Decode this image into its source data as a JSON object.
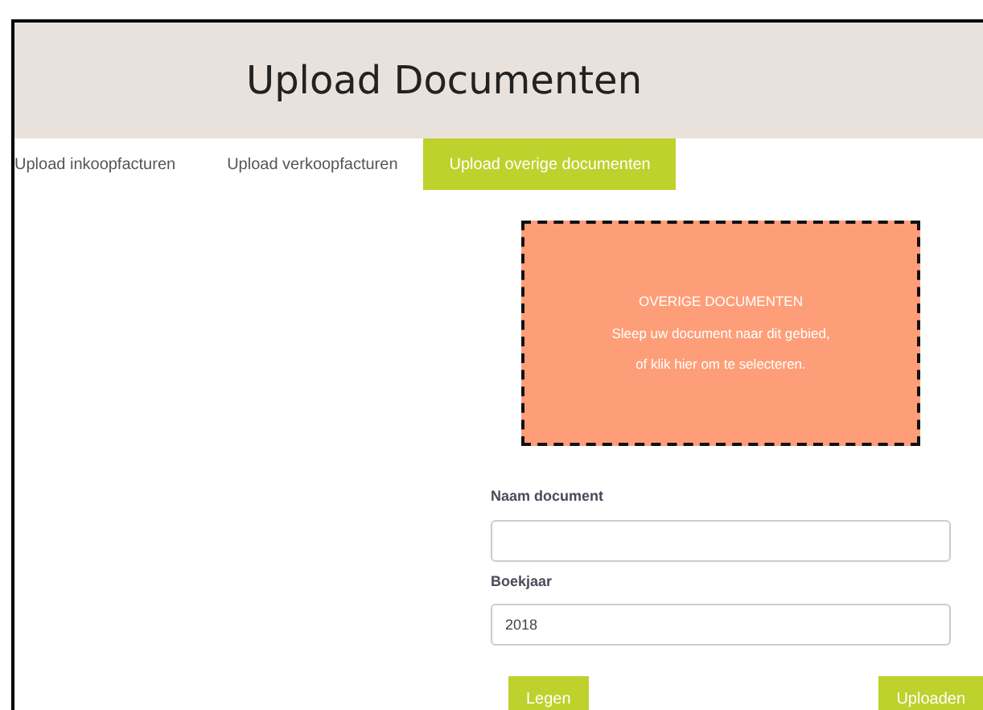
{
  "header": {
    "title": "Upload Documenten"
  },
  "tabs": [
    {
      "label": "Upload inkoopfacturen",
      "selected": false
    },
    {
      "label": "Upload verkoopfacturen",
      "selected": false
    },
    {
      "label": "Upload overige documenten",
      "selected": true
    }
  ],
  "dropzone": {
    "title": "OVERIGE DOCUMENTEN",
    "lines": [
      "Sleep uw document naar dit gebied,",
      "of klik hier om te selecteren."
    ]
  },
  "form": {
    "fields": [
      {
        "label": "Naam document"
      },
      {
        "label": "Boekjaar",
        "value": "2018"
      }
    ],
    "buttons": [
      {
        "label": "Legen"
      },
      {
        "label": "Uploaden"
      }
    ]
  }
}
